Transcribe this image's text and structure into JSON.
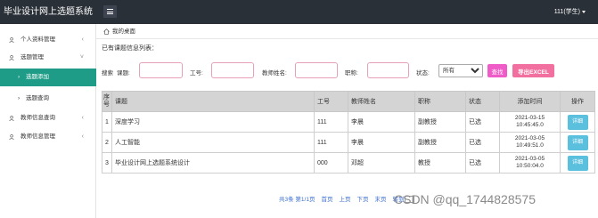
{
  "app": {
    "title": "毕业设计网上选题系统"
  },
  "header": {
    "user_label": "111(学生)"
  },
  "sidebar": {
    "items": [
      {
        "label": "个人资料管理",
        "chevron": "‹"
      },
      {
        "label": "选题管理",
        "chevron": "˅"
      },
      {
        "label": "选题添加",
        "arrow": "›"
      },
      {
        "label": "选题查询",
        "arrow": "›"
      },
      {
        "label": "教师信息查询",
        "chevron": "‹"
      },
      {
        "label": "教师信息管理",
        "chevron": "‹"
      }
    ]
  },
  "breadcrumb": {
    "label": "我的桌面"
  },
  "list": {
    "title": "已有课题信息列表："
  },
  "search": {
    "prefix": "搜索",
    "topic_label": "课题:",
    "id_label": "工号:",
    "teacher_label": "教师姓名:",
    "title_label": "职称:",
    "status_label": "状态:",
    "status_selected": "所有",
    "search_button": "查找",
    "excel_button": "导出EXCEL"
  },
  "table": {
    "headers": [
      "序号",
      "课题",
      "工号",
      "教师姓名",
      "职称",
      "状态",
      "添加时间",
      "操作"
    ],
    "rows": [
      {
        "no": "1",
        "topic": "深度学习",
        "id": "111",
        "teacher": "李晨",
        "title": "副教授",
        "status": "已选",
        "date": "2021-03-15",
        "time": "10:45:45.0",
        "action": "详细"
      },
      {
        "no": "2",
        "topic": "人工智能",
        "id": "111",
        "teacher": "李晨",
        "title": "副教授",
        "status": "已选",
        "date": "2021-03-05",
        "time": "10:49:51.0",
        "action": "详细"
      },
      {
        "no": "3",
        "topic": "毕业设计网上选题系统设计",
        "id": "000",
        "teacher": "邓超",
        "title": "教授",
        "status": "已选",
        "date": "2021-03-05",
        "time": "10:50:04.0",
        "action": "详细"
      }
    ]
  },
  "pager": {
    "summary": "共3条 第1/1页",
    "first": "首页",
    "prev": "上页",
    "next": "下页",
    "last": "末页",
    "goto": "转到"
  },
  "watermark": "CSDN @qq_1744828575",
  "colors": {
    "sidebar_active": "#1f9c88",
    "topbar": "#2a3038",
    "search_button": "#ef5cc8",
    "excel_button": "#f2709f",
    "detail_button": "#5bc0de"
  }
}
